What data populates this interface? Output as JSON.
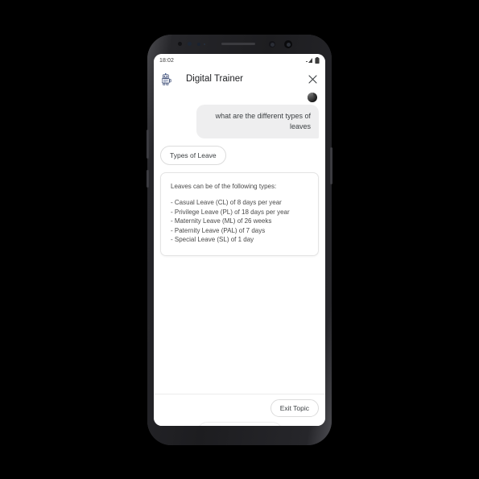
{
  "device": {
    "name": "android-phone",
    "hardware": {
      "earpiece": "earpiece-speaker",
      "front_camera": "front-camera",
      "proximity_sensor": "proximity-sensor",
      "power_button": "power-button",
      "volume_button": "volume-button"
    }
  },
  "status_bar": {
    "time": "18:02",
    "icons": [
      "signal-icon",
      "wifi-icon",
      "battery-icon"
    ]
  },
  "header": {
    "trainer_icon": "robot-icon",
    "title": "Digital Trainer",
    "close_label": "✕"
  },
  "chat": {
    "user_avatar": "user-avatar",
    "user_message": "what are the different types of leaves",
    "topic_chip": "Types of Leave",
    "answer_card": {
      "intro": "Leaves can be of the following types:",
      "items": [
        "- Casual Leave (CL) of 8 days per year",
        "- Privilege Leave (PL) of 18 days per year",
        "- Maternity Leave (ML) of 26 weeks",
        "- Paternity Leave (PAL) of 7 days",
        "- Special Leave (SL) of 1 day"
      ]
    }
  },
  "bottom": {
    "exit_topic_label": "Exit Topic",
    "input_icons": [
      "google-lens-icon",
      "google-mic-icon",
      "keyboard-icon"
    ]
  },
  "nav_bar": {
    "back": "back-button",
    "home": "home-button",
    "recents": "recents-button"
  },
  "colors": {
    "background": "#000000",
    "screen": "#ffffff",
    "bubble": "#eeeeef",
    "text": "#3c4043",
    "muted_text": "#4a4a4a",
    "border": "#dcdcdc",
    "mic_blue": "#4285f4",
    "mic_red": "#ea4335",
    "mic_yellow": "#fbbc05",
    "mic_green": "#34a853"
  }
}
